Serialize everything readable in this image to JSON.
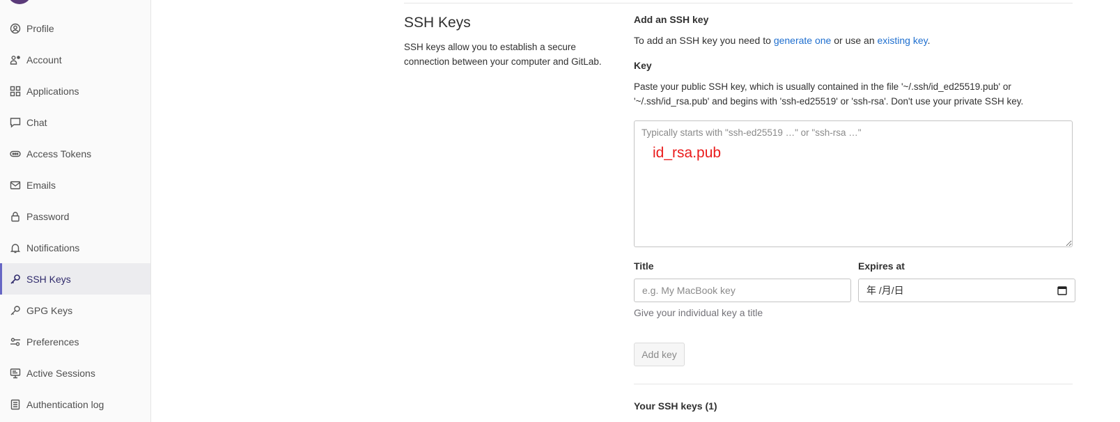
{
  "sidebar": {
    "items": [
      {
        "label": "Profile",
        "icon": "profile-icon"
      },
      {
        "label": "Account",
        "icon": "account-icon"
      },
      {
        "label": "Applications",
        "icon": "applications-icon"
      },
      {
        "label": "Chat",
        "icon": "chat-icon"
      },
      {
        "label": "Access Tokens",
        "icon": "token-icon"
      },
      {
        "label": "Emails",
        "icon": "mail-icon"
      },
      {
        "label": "Password",
        "icon": "lock-icon"
      },
      {
        "label": "Notifications",
        "icon": "bell-icon"
      },
      {
        "label": "SSH Keys",
        "icon": "key-icon",
        "active": true
      },
      {
        "label": "GPG Keys",
        "icon": "key-icon"
      },
      {
        "label": "Preferences",
        "icon": "preferences-icon"
      },
      {
        "label": "Active Sessions",
        "icon": "monitor-icon"
      },
      {
        "label": "Authentication log",
        "icon": "log-icon"
      }
    ]
  },
  "section": {
    "title": "SSH Keys",
    "description": "SSH keys allow you to establish a secure connection between your computer and GitLab."
  },
  "form": {
    "add_heading": "Add an SSH key",
    "add_text_before": "To add an SSH key you need to ",
    "generate_link": "generate one",
    "add_text_middle": " or use an ",
    "existing_link": "existing key",
    "add_text_after": ".",
    "key_label": "Key",
    "key_help": "Paste your public SSH key, which is usually contained in the file '~/.ssh/id_ed25519.pub' or '~/.ssh/id_rsa.pub' and begins with 'ssh-ed25519' or 'ssh-rsa'. Don't use your private SSH key.",
    "key_placeholder": "Typically starts with \"ssh-ed25519 …\" or \"ssh-rsa …\"",
    "key_value": "",
    "annotation": "id_rsa.pub",
    "title_label": "Title",
    "title_placeholder": "e.g. My MacBook key",
    "title_value": "",
    "title_help": "Give your individual key a title",
    "expires_label": "Expires at",
    "expires_value": "年 /月/日",
    "add_button": "Add key",
    "your_keys_heading": "Your SSH keys (1)"
  },
  "colors": {
    "link": "#1f6fcf",
    "annotation": "#ea1b1b",
    "active_bar": "#6666c4"
  }
}
